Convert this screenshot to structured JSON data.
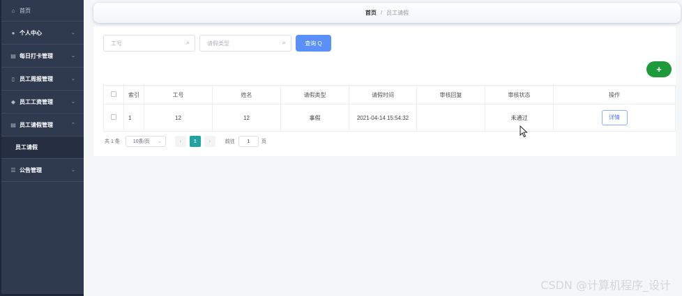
{
  "sidebar": {
    "home": {
      "label": "首页",
      "icon": "home-icon"
    },
    "items": [
      {
        "label": "个人中心",
        "icon": "user-icon"
      },
      {
        "label": "每日打卡管理",
        "icon": "list-icon"
      },
      {
        "label": "员工周报管理",
        "icon": "phone-icon"
      },
      {
        "label": "员工工资管理",
        "icon": "pin-icon"
      },
      {
        "label": "员工请假管理",
        "icon": "list-icon",
        "expanded": true,
        "sub": [
          {
            "label": "员工请假"
          }
        ]
      },
      {
        "label": "公告管理",
        "icon": "sliders-icon"
      }
    ]
  },
  "breadcrumb": {
    "home": "首页",
    "separator": "/",
    "current": "员工请假"
  },
  "search": {
    "employee_id_placeholder": "工号",
    "leave_type_placeholder": "请假类型",
    "query_label": "查询 Q"
  },
  "add_label": "+",
  "table": {
    "headers": [
      "索引",
      "工号",
      "姓名",
      "请假类型",
      "请假时间",
      "审核回复",
      "审核状态",
      "操作"
    ],
    "rows": [
      {
        "index": "1",
        "employee_id": "12",
        "name": "12",
        "leave_type": "事假",
        "leave_time": "2021-04-14 15:54:32",
        "reply": "",
        "status": "未通过",
        "action": "详情"
      }
    ]
  },
  "pagination": {
    "total": "共 1 条",
    "page_size": "10条/页",
    "prev": "‹",
    "current_page": "1",
    "next": "›",
    "goto_label": "前往",
    "goto_value": "1",
    "goto_suffix": "页"
  },
  "watermark": "CSDN @计算机程序_设计",
  "colors": {
    "sidebar_bg": "#2f3a4f",
    "primary": "#5b8ff9",
    "add": "#1f9a3a",
    "active_page": "#1fa4a0"
  }
}
